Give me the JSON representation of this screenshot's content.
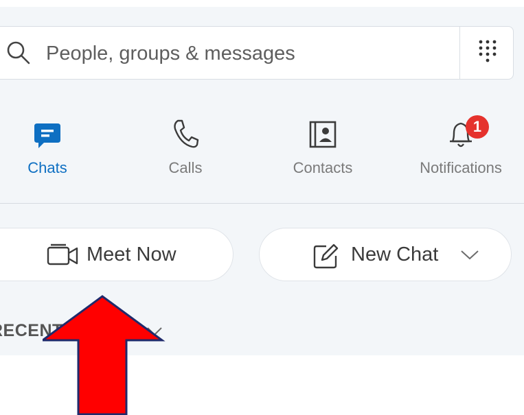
{
  "search": {
    "placeholder": "People, groups & messages"
  },
  "tabs": [
    {
      "label": "Chats",
      "active": true
    },
    {
      "label": "Calls",
      "active": false
    },
    {
      "label": "Contacts",
      "active": false
    },
    {
      "label": "Notifications",
      "active": false,
      "badge": "1"
    }
  ],
  "actions": {
    "meet_now": "Meet Now",
    "new_chat": "New Chat"
  },
  "recent": {
    "label": "RECENT CHATS"
  },
  "colors": {
    "accent": "#0e6fc2",
    "badge": "#e5322d",
    "arrow": "#ff0000",
    "arrow_outline": "#1f2a6b"
  }
}
